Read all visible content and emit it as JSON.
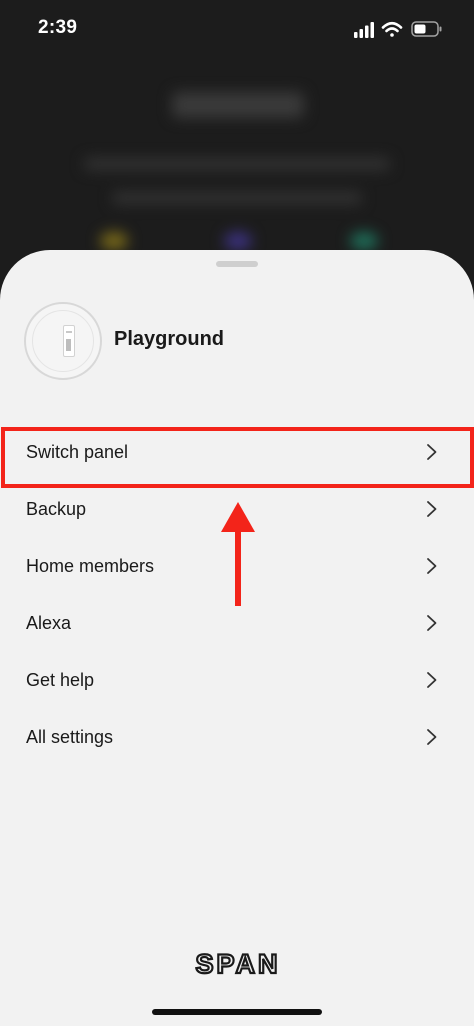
{
  "status_bar": {
    "time": "2:39"
  },
  "sheet": {
    "home_name": "Playground",
    "menu_items": [
      {
        "label": "Switch panel"
      },
      {
        "label": "Backup"
      },
      {
        "label": "Home members"
      },
      {
        "label": "Alexa"
      },
      {
        "label": "Get help"
      },
      {
        "label": "All settings"
      }
    ]
  },
  "brand": {
    "logo_text": "SPAN"
  },
  "colors": {
    "sheet_background": "#f2f2f2",
    "backdrop": "#1c1c1c",
    "highlight": "#f3241a",
    "text": "#1a1a1a"
  },
  "icons": {
    "chevron": "chevron-right-icon",
    "avatar": "panel-device-icon"
  }
}
